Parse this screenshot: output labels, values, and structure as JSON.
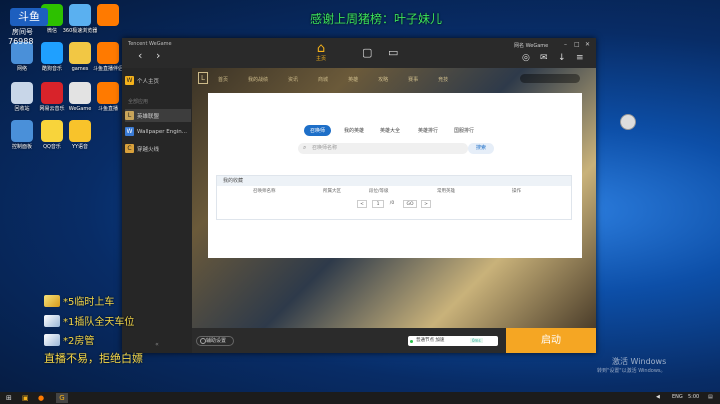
{
  "stream": {
    "title": "感谢上周猪榜：叶子妹儿",
    "room_label": "房间号",
    "room_number": "76988",
    "room_brand": "斗鱼",
    "overlay": [
      {
        "icon": "gold-gift-icon",
        "text": "*5临时上车"
      },
      {
        "icon": "plane-gift-icon",
        "text": "*1插队全天车位"
      },
      {
        "icon": "plane-gift-icon",
        "text": "*2房管"
      }
    ],
    "overlay_bottom": "直播不易，拒绝白嫖"
  },
  "desktop_icons": [
    {
      "name": "recycle-bin-icon",
      "label": "此电脑",
      "color": "#6da7e8"
    },
    {
      "name": "wechat-icon",
      "label": "微信",
      "color": "#2dc100"
    },
    {
      "name": "360-browser-icon",
      "label": "360极速浏览器",
      "color": "#5ab0f0"
    },
    {
      "name": "douyu-icon",
      "label": "",
      "color": "#ff7a00"
    },
    {
      "name": "network-icon",
      "label": "网络",
      "color": "#4a90d9"
    },
    {
      "name": "kugou-icon",
      "label": "酷狗音乐",
      "color": "#1fa0ff"
    },
    {
      "name": "games-folder-icon",
      "label": "games",
      "color": "#f2c744"
    },
    {
      "name": "douyu-companion-icon",
      "label": "斗鱼直播伴侣",
      "color": "#ff7a00"
    },
    {
      "name": "trash-icon",
      "label": "回收站",
      "color": "#c8d6e8"
    },
    {
      "name": "netease-music-icon",
      "label": "网易云音乐",
      "color": "#d8232a"
    },
    {
      "name": "wegame-icon",
      "label": "WeGame",
      "color": "#e3e3e3"
    },
    {
      "name": "douyu-live-icon",
      "label": "斗鱼直播",
      "color": "#ff7a00"
    },
    {
      "name": "control-panel-icon",
      "label": "控制面板",
      "color": "#4a90d9"
    },
    {
      "name": "qq-music-icon",
      "label": "QQ音乐",
      "color": "#f8d43b"
    },
    {
      "name": "yy-voice-icon",
      "label": "YY语音",
      "color": "#f8c32b"
    }
  ],
  "window": {
    "brand": "Tencent WeGame",
    "home_tab": "主页",
    "user": "网名 WeGame",
    "sidebar": [
      {
        "label": "个人主页",
        "icon": "W",
        "color": "#f5b21b",
        "active": false
      },
      {
        "label": "英雄联盟",
        "icon": "L",
        "color": "#c9a55a",
        "active": true
      },
      {
        "label": "Wallpaper Engin...",
        "icon": "W",
        "color": "#3a7bd5",
        "active": false
      },
      {
        "label": "穿越火线",
        "icon": "C",
        "color": "#d9a13b",
        "active": false
      }
    ],
    "sidebar_header": "全部应用",
    "game_nav": [
      "首页",
      "我的战绩",
      "资讯",
      "商城",
      "英雄",
      "攻略",
      "赛事",
      "竞技"
    ],
    "panel": {
      "tabs": [
        "召唤师",
        "我的英雄",
        "英雄大全",
        "英雄排行",
        "国服排行"
      ],
      "active_tab": 0,
      "search_placeholder": "召唤师名称",
      "search_button": "搜索",
      "favorites_title": "我的收藏",
      "columns": [
        "召唤师名称",
        "所属大区",
        "段位/等级",
        "常用英雄",
        "操作"
      ],
      "pager": {
        "prev": "<",
        "current": "1",
        "total": "/0",
        "go": "GO",
        "next": ">"
      }
    },
    "footer": {
      "assist": "辅助设置",
      "speed": "普通节点 加速",
      "speed_badge": "0ms",
      "launch": "启动"
    }
  },
  "taskbar": {
    "tray": [
      "ENG",
      "5:00"
    ]
  },
  "watermark": {
    "line1": "激活 Windows",
    "line2": "转到\"设置\"以激活 Windows。"
  }
}
